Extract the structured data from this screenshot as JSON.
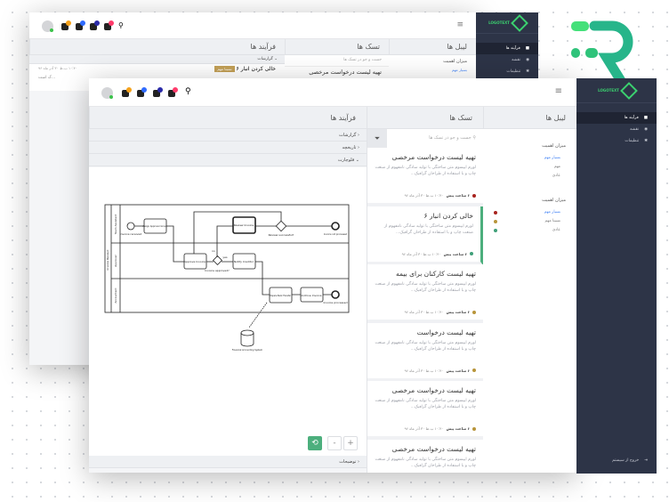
{
  "brand": {
    "logo_text": "LOGOTEXT",
    "accent": "#3bd16f",
    "sidebar_bg": "#2d3447"
  },
  "sidebar": {
    "items": [
      {
        "label": "فرآیند ها",
        "icon": "briefcase-icon"
      },
      {
        "label": "نقشه",
        "icon": "location-pin-icon"
      },
      {
        "label": "تنظیمات",
        "icon": "gear-icon"
      }
    ],
    "logout": "خروج از سیستم"
  },
  "columns": {
    "labels": "لیبل ها",
    "tasks": "تسک ها",
    "processes": "فرآیند ها"
  },
  "search": {
    "placeholder": "جست و جو در تسک ها"
  },
  "labels": {
    "group1": {
      "title": "میزان اهمیت",
      "items": [
        "بسیار مهم",
        "مهم",
        "عادی"
      ]
    },
    "group2": {
      "title": "میزان اهمیت",
      "items": [
        {
          "label": "بسیار مهم",
          "color": "#a8231f"
        },
        {
          "label": "نسبتا مهم",
          "color": "#b8953a"
        },
        {
          "label": "عادی",
          "color": "#3f9f78"
        }
      ]
    }
  },
  "process": {
    "accordions": [
      "گزارشات",
      "تاریخچه",
      "فلوچارت"
    ],
    "footer": "توضیحات",
    "zoom_in": "+",
    "zoom_out": "-"
  },
  "tasks": [
    {
      "title": "تهیه لیست درخواست مرخصی",
      "desc": "لورم ایپسوم متن ساختگی با تولید سادگی نامفهوم از صنعت چاپ و با استفاده از طراحان گرافیک...",
      "ago": "۶ ساعت پیش",
      "date": "۱۰:۴۰ ب.ظ ۳۰ آذر ماه ۹۶",
      "color": "#a8231f"
    },
    {
      "title": "خالی کردن انبار ۶",
      "desc": "لورم ایپسوم متن ساختگی با تولید سادگی نامفهوم از صنعت چاپ و با استفاده از طراحان گرافیک...",
      "ago": "۶ ساعت پیش",
      "date": "۱۰:۴۰ ب.ظ ۳۰ آذر ماه ۹۶",
      "color": "#3f9f78"
    },
    {
      "title": "تهیه لیست کارکنان برای بیمه",
      "desc": "لورم ایپسوم متن ساختگی با تولید سادگی نامفهوم از صنعت چاپ و با استفاده از طراحان گرافیک...",
      "ago": "۶ ساعت پیش",
      "date": "۱۰:۴۰ ب.ظ ۳۰ آذر ماه ۹۶",
      "color": "#b8953a"
    },
    {
      "title": "تهیه لیست درخواست",
      "desc": "لورم ایپسوم متن ساختگی با تولید سادگی نامفهوم از صنعت چاپ و با استفاده از طراحان گرافیک...",
      "ago": "۶ ساعت پیش",
      "date": "۱۰:۴۰ ب.ظ ۳۰ آذر ماه ۹۶",
      "color": "#b8953a"
    },
    {
      "title": "تهیه لیست درخواست مرخصی",
      "desc": "لورم ایپسوم متن ساختگی با تولید سادگی نامفهوم از صنعت چاپ و با استفاده از طراحان گرافیک...",
      "ago": "۶ ساعت پیش",
      "date": "۱۰:۴۰ ب.ظ ۳۰ آذر ماه ۹۶",
      "color": "#b8953a"
    },
    {
      "title": "تهیه لیست درخواست مرخصی",
      "desc": "لورم ایپسوم متن ساختگی با تولید سادگی نامفهوم از صنعت چاپ و با استفاده از طراحان گرافیک...",
      "ago": "",
      "date": "",
      "color": "#b8953a"
    }
  ],
  "back": {
    "report_title": "خالی کردن انبار ۶",
    "badge": "نسبتا مهم",
    "date": "۱۰:۴۰ ب.ظ ۳۰ آذر ماه ۹۶",
    "snippet": "...ک است",
    "task1": "تهیه لیست درخواست مرخصی",
    "label_item": "بسیار مهم"
  },
  "header": {
    "badges": [
      "#f4a11a",
      "#2f6bff",
      "#2a2aa8",
      "#ff3b6b"
    ]
  },
  "diagram": {
    "pool": "Invoice Receipt",
    "lanes": [
      "Team Assistant",
      "Approver",
      "Accountant"
    ],
    "nodes": {
      "start": "Invoice received",
      "assign": "Assign Approver Group",
      "review": "Review Invoice",
      "review_ok": "Review successful?",
      "not_processed": "Invoice not processed",
      "approve": "Approve Invoice",
      "approved": "Invoice approved?",
      "notify": "Notify Creditor",
      "prepare": "Prepare Bank Transfer",
      "archive": "Archive Invoice",
      "processed": "Invoice processed",
      "system": "Financial Accounting System"
    },
    "yes": "yes",
    "no": "no"
  }
}
